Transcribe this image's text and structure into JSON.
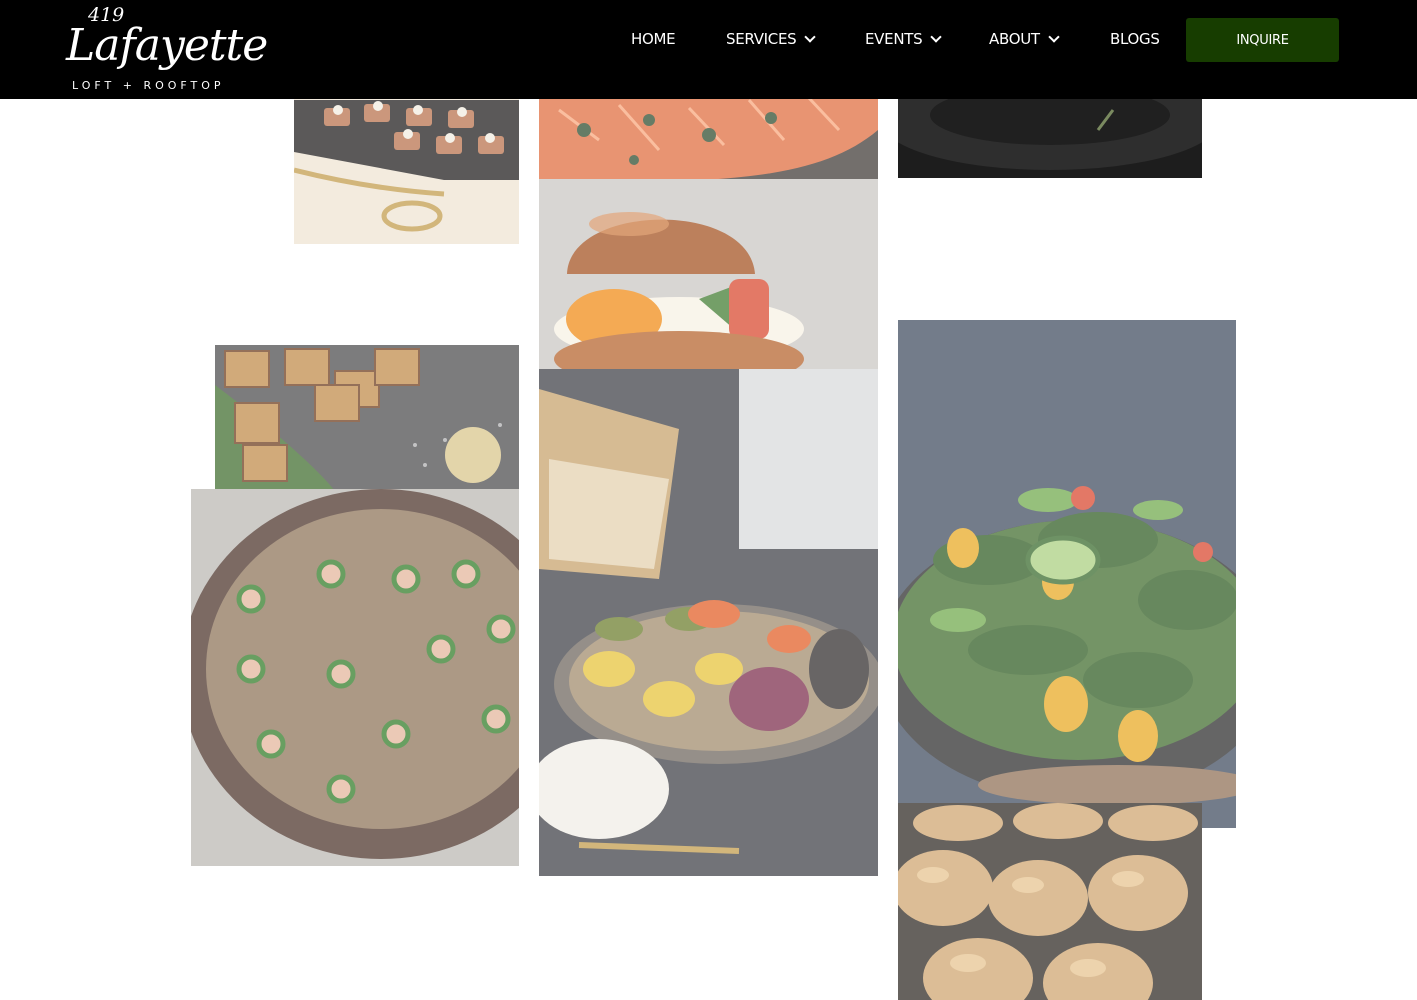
{
  "header": {
    "logo": {
      "number": "419",
      "name": "Lafayette",
      "tagline": "LOFT + ROOFTOP"
    },
    "nav": [
      {
        "label": "HOME"
      },
      {
        "label": "SERVICES"
      },
      {
        "label": "EVENTS"
      },
      {
        "label": "ABOUT"
      },
      {
        "label": "BLOGS"
      }
    ],
    "cta": {
      "label": "INQUIRE"
    }
  },
  "colors": {
    "header_bg": "#000000",
    "cta_bg": "#173d00",
    "text": "#ffffff"
  },
  "gallery": [
    {
      "subject": "canapes-on-black-tray"
    },
    {
      "subject": "sliced-salmon-platter"
    },
    {
      "subject": "dark-plate"
    },
    {
      "subject": "breakfast-sandwich"
    },
    {
      "subject": "grilled-cheese-bites"
    },
    {
      "subject": "jalapeno-tartare-bites"
    },
    {
      "subject": "grilled-vegetables-and-pita"
    },
    {
      "subject": "green-salad"
    },
    {
      "subject": "slider-buns"
    }
  ]
}
